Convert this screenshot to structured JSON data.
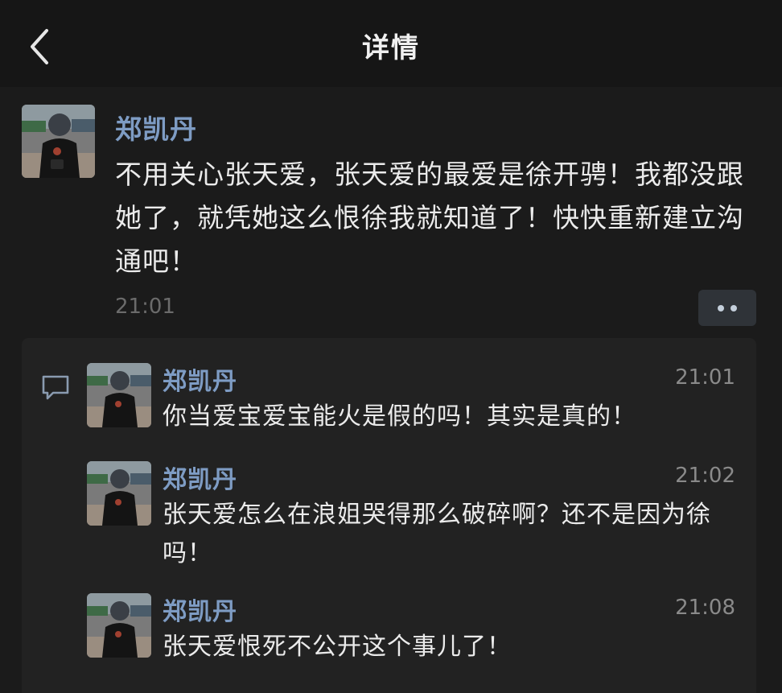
{
  "header": {
    "title": "详情",
    "back_icon": "chevron-left-icon"
  },
  "post": {
    "author": "郑凯丹",
    "text": "不用关心张天爱，张天爱的最爱是徐开骋！我都没跟她了，就凭她这么恨徐我就知道了！快快重新建立沟通吧！",
    "time": "21:01",
    "more_icon": "more-dots-icon"
  },
  "replies": [
    {
      "author": "郑凯丹",
      "time": "21:01",
      "text": "你当爱宝爱宝能火是假的吗！其实是真的！"
    },
    {
      "author": "郑凯丹",
      "time": "21:02",
      "text": "张天爱怎么在浪姐哭得那么破碎啊？还不是因为徐吗！"
    },
    {
      "author": "郑凯丹",
      "time": "21:08",
      "text": "张天爱恨死不公开这个事儿了！"
    }
  ],
  "colors": {
    "background": "#1b1b1b",
    "header_background": "#161616",
    "name_blue": "#7e9cc4",
    "text": "#ebebeb",
    "muted": "#6b6b6b"
  }
}
